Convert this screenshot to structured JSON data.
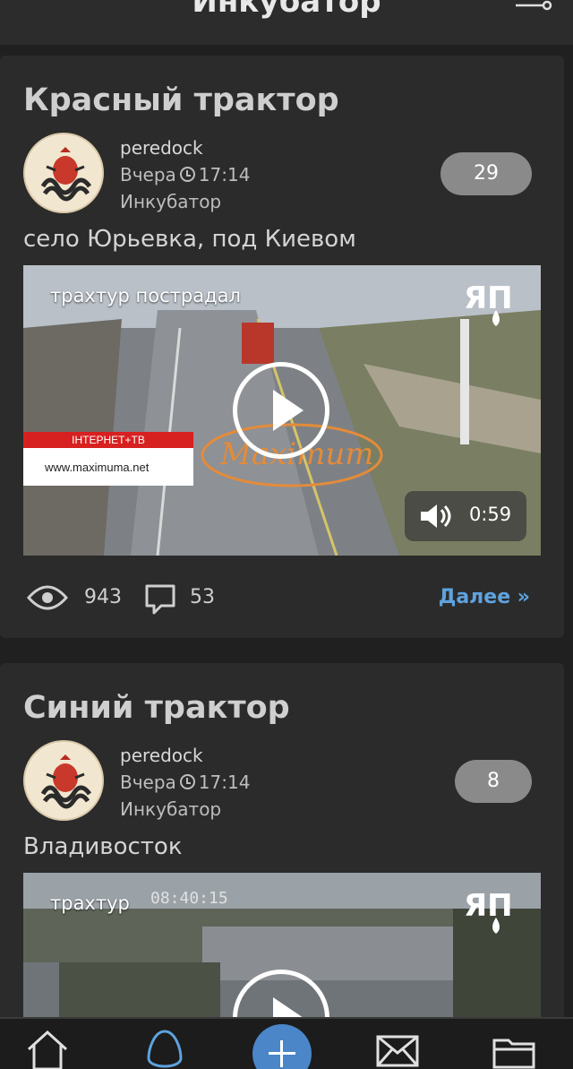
{
  "header": {
    "title": "Инкубатор",
    "menu_icon": "hamburger-icon",
    "filter_icon": "filter-icon"
  },
  "posts": [
    {
      "title": "Красный трактор",
      "author": "peredock",
      "date": "Вчера",
      "time": "17:14",
      "category": "Инкубатор",
      "rating": "29",
      "location": "село Юрьевка, под Киевом",
      "video": {
        "caption": "трахтур пострадал",
        "duration": "0:59",
        "banner_top": "ІНТЕРНЕТ+ТВ",
        "banner_url": "www.maximuma.net"
      },
      "views": "943",
      "comments": "53",
      "more": "Далее »"
    },
    {
      "title": "Синий трактор",
      "author": "peredock",
      "date": "Вчера",
      "time": "17:14",
      "category": "Инкубатор",
      "rating": "8",
      "location": "Владивосток",
      "video": {
        "caption": "трахтур",
        "timestamp": "08:40:15"
      }
    }
  ],
  "navbar": {
    "items": [
      "home-icon",
      "egg-icon",
      "add-icon",
      "mail-icon",
      "folder-icon"
    ]
  },
  "colors": {
    "background": "#202020",
    "card": "#2b2b2b",
    "accent": "#4a86c8",
    "link": "#5ea3de",
    "badge": "#8a8a8a"
  }
}
